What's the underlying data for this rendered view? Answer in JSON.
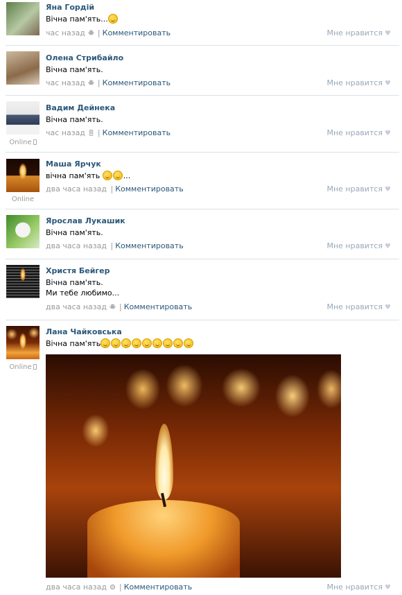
{
  "comments": [
    {
      "author": "Яна Гордій",
      "text": "Вічна пам'ять...",
      "time": "час назад",
      "reply": "Комментировать",
      "like": "Мне нравится",
      "avatar_colors": [
        "#6d8e5a",
        "#a7b79a"
      ]
    },
    {
      "author": "Олена Стрибайло",
      "text": "Вічна пам'ять.",
      "time": "час назад",
      "reply": "Комментировать",
      "like": "Мне нравится",
      "avatar_colors": [
        "#8a6a4a",
        "#c9b59a"
      ]
    },
    {
      "author": "Вадим Дейнека",
      "text": "Вічна пам'ять.",
      "time": "час назад",
      "reply": "Комментировать",
      "like": "Мне нравится",
      "online": "Online",
      "avatar_colors": [
        "#e8e8e8",
        "#4a5a78"
      ]
    },
    {
      "author": "Маша Ярчук",
      "text": "вічна пам'ять",
      "time": "два часа назад",
      "reply": "Комментировать",
      "like": "Мне нравится",
      "online": "Online",
      "avatar_colors": [
        "#2a1004",
        "#f09a2a"
      ]
    },
    {
      "author": "Ярослав Лукашик",
      "text": "Вічна пам'ять.",
      "time": "два часа назад",
      "reply": "Комментировать",
      "like": "Мне нравится",
      "avatar_colors": [
        "#6aa24a",
        "#d8e8c8"
      ]
    },
    {
      "author": "Христя Бейгер",
      "text": "Вічна пам'ять.",
      "text2": "Ми тебе любимо...",
      "time": "два часа назад",
      "reply": "Комментировать",
      "like": "Мне нравится",
      "avatar_colors": [
        "#1a1a1a",
        "#c0c0c0"
      ]
    },
    {
      "author": "Лана Чайковська",
      "text": "Вічна пам'ять",
      "time": "два часа назад",
      "reply": "Комментировать",
      "like": "Мне нравится",
      "online": "Online",
      "avatar_colors": [
        "#3a1204",
        "#f2a33a"
      ]
    }
  ],
  "icons": {
    "android": "android-icon",
    "mobile": "mobile-phone-icon",
    "app": "app-gear-icon",
    "heart": "heart-icon",
    "emoji": "smiley-emoji-icon"
  },
  "colors": {
    "author_link": "#2b587a",
    "meta_text": "#999999",
    "like_text": "#99a8b8",
    "separator": "#dae1e8"
  }
}
